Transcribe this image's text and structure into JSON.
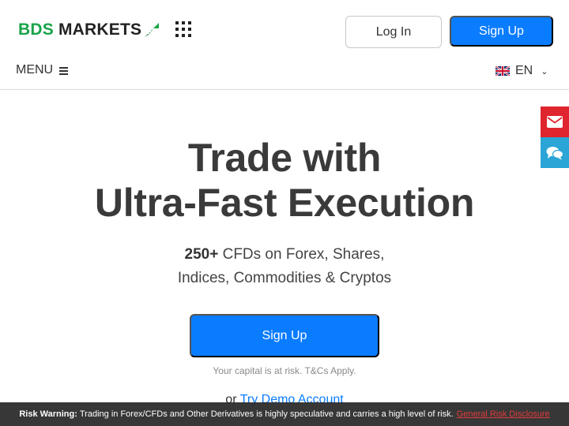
{
  "header": {
    "logo": {
      "part1": "BDS",
      "part2": "MARKETS"
    },
    "login_label": "Log In",
    "signup_label": "Sign Up",
    "menu_label": "MENU",
    "language": "EN"
  },
  "hero": {
    "title_line1": "Trade with",
    "title_line2": "Ultra-Fast Execution",
    "sub_bold": "250+",
    "sub_line1_rest": " CFDs on Forex, Shares,",
    "sub_line2": "Indices, Commodities & Cryptos",
    "cta_label": "Sign Up",
    "capital_note": "Your capital is at risk. T&Cs Apply.",
    "demo_prefix": "or",
    "demo_link": "Try Demo Account"
  },
  "risk_bar": {
    "label": "Risk Warning:",
    "text": "Trading in Forex/CFDs and Other Derivatives is highly speculative and carries a high level of risk.",
    "link": "General Risk Disclosure"
  },
  "icons": {
    "menu": "hamburger-icon",
    "apps": "apps-grid-icon",
    "flag": "uk-flag-icon",
    "chevron": "chevron-down-icon",
    "mail": "envelope-icon",
    "chat": "chat-icon"
  },
  "colors": {
    "brand_green": "#1aa34a",
    "primary_blue": "#0a7cff",
    "mail_red": "#e0252f",
    "chat_blue": "#2aa5d6",
    "risk_link": "#e23b3b"
  }
}
